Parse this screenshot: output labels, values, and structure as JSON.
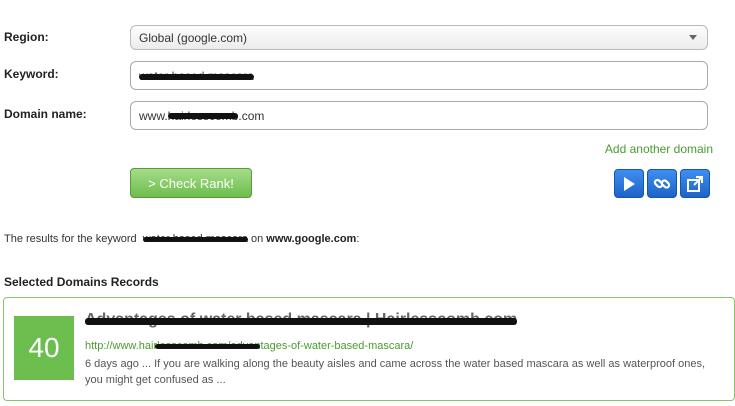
{
  "form": {
    "region_label": "Region:",
    "region_value": "Global (google.com)",
    "keyword_label": "Keyword:",
    "keyword_value": "water based mascara",
    "domain_label": "Domain name:",
    "domain_prefix": "www.",
    "domain_value": "hairlesscomb",
    "domain_suffix": ".com",
    "add_domain_link": "Add another domain",
    "check_button": "> Check Rank!"
  },
  "toolbar": {
    "icons": [
      "play-icon",
      "link-icon",
      "share-icon"
    ],
    "accent": "#2a74d8"
  },
  "results": {
    "prefix": "The results for the keyword",
    "keyword": "water based mascara",
    "on_text": "on",
    "engine": "www.google.com",
    "suffix": ":"
  },
  "records": {
    "section_title": "Selected Domains Records",
    "items": [
      {
        "rank": "40",
        "title": "Advantages of water based mascara | Hairlesscomb.com",
        "url": "http://www.hairlesscomb.com/advantages-of-water-based-mascara/",
        "snippet": "6 days ago ... If you are walking along the beauty aisles and came across the water based mascara as well as waterproof ones, you might get confused as ..."
      }
    ]
  },
  "colors": {
    "green_accent": "#6cbf4f",
    "link_green": "#4a9c2f",
    "button_blue": "#2a74d8"
  }
}
